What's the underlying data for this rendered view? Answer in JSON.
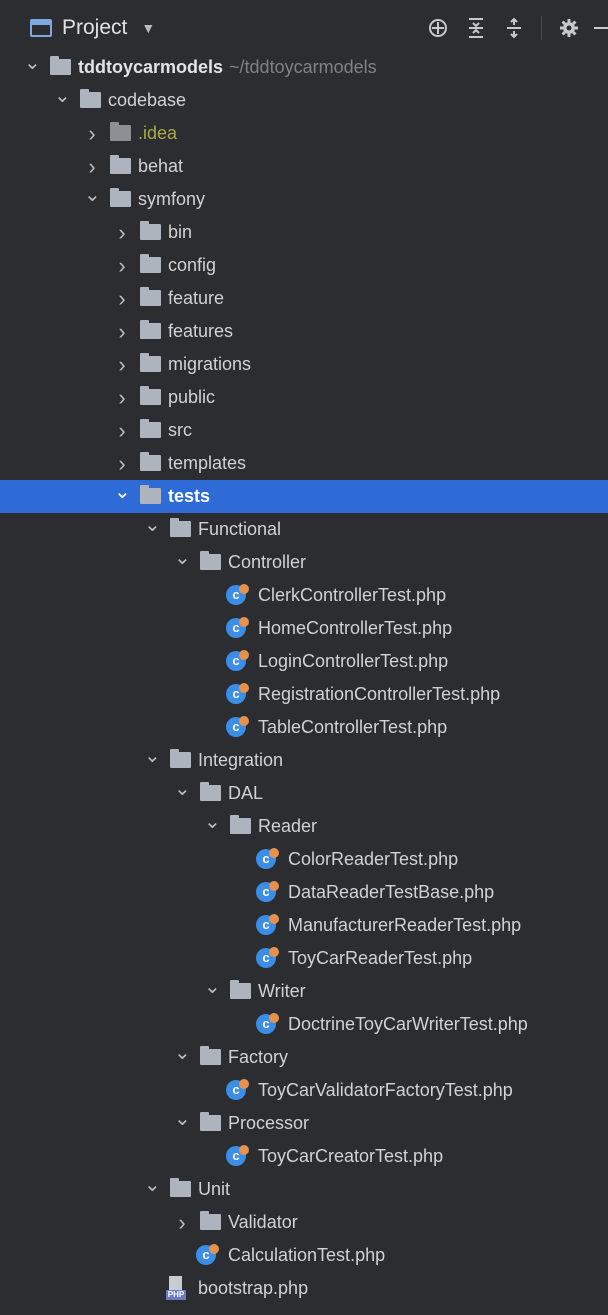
{
  "toolbar": {
    "title": "Project",
    "icons": [
      "locate-icon",
      "collapse-all-icon",
      "expand-all-icon",
      "gear-icon",
      "hide-icon"
    ]
  },
  "tree": [
    {
      "label": "tddtoycarmodels",
      "hint": "~/tddtoycarmodels",
      "type": "folder",
      "depth": 0,
      "expanded": true,
      "root": true
    },
    {
      "label": "codebase",
      "type": "folder",
      "depth": 1,
      "expanded": true
    },
    {
      "label": ".idea",
      "type": "folder-excluded",
      "depth": 2,
      "expanded": false
    },
    {
      "label": "behat",
      "type": "folder",
      "depth": 2,
      "expanded": false
    },
    {
      "label": "symfony",
      "type": "folder",
      "depth": 2,
      "expanded": true
    },
    {
      "label": "bin",
      "type": "folder",
      "depth": 3,
      "expanded": false
    },
    {
      "label": "config",
      "type": "folder",
      "depth": 3,
      "expanded": false
    },
    {
      "label": "feature",
      "type": "folder",
      "depth": 3,
      "expanded": false
    },
    {
      "label": "features",
      "type": "folder",
      "depth": 3,
      "expanded": false
    },
    {
      "label": "migrations",
      "type": "folder",
      "depth": 3,
      "expanded": false
    },
    {
      "label": "public",
      "type": "folder",
      "depth": 3,
      "expanded": false
    },
    {
      "label": "src",
      "type": "folder",
      "depth": 3,
      "expanded": false
    },
    {
      "label": "templates",
      "type": "folder",
      "depth": 3,
      "expanded": false
    },
    {
      "label": "tests",
      "type": "folder",
      "depth": 3,
      "expanded": true,
      "selected": true
    },
    {
      "label": "Functional",
      "type": "folder",
      "depth": 4,
      "expanded": true
    },
    {
      "label": "Controller",
      "type": "folder",
      "depth": 5,
      "expanded": true
    },
    {
      "label": "ClerkControllerTest.php",
      "type": "php-class",
      "depth": 6
    },
    {
      "label": "HomeControllerTest.php",
      "type": "php-class",
      "depth": 6
    },
    {
      "label": "LoginControllerTest.php",
      "type": "php-class",
      "depth": 6
    },
    {
      "label": "RegistrationControllerTest.php",
      "type": "php-class",
      "depth": 6
    },
    {
      "label": "TableControllerTest.php",
      "type": "php-class",
      "depth": 6
    },
    {
      "label": "Integration",
      "type": "folder",
      "depth": 4,
      "expanded": true
    },
    {
      "label": "DAL",
      "type": "folder",
      "depth": 5,
      "expanded": true
    },
    {
      "label": "Reader",
      "type": "folder",
      "depth": 6,
      "expanded": true
    },
    {
      "label": "ColorReaderTest.php",
      "type": "php-class",
      "depth": 7
    },
    {
      "label": "DataReaderTestBase.php",
      "type": "php-class",
      "depth": 7
    },
    {
      "label": "ManufacturerReaderTest.php",
      "type": "php-class",
      "depth": 7
    },
    {
      "label": "ToyCarReaderTest.php",
      "type": "php-class",
      "depth": 7
    },
    {
      "label": "Writer",
      "type": "folder",
      "depth": 6,
      "expanded": true
    },
    {
      "label": "DoctrineToyCarWriterTest.php",
      "type": "php-class",
      "depth": 7
    },
    {
      "label": "Factory",
      "type": "folder",
      "depth": 5,
      "expanded": true
    },
    {
      "label": "ToyCarValidatorFactoryTest.php",
      "type": "php-class",
      "depth": 6
    },
    {
      "label": "Processor",
      "type": "folder",
      "depth": 5,
      "expanded": true
    },
    {
      "label": "ToyCarCreatorTest.php",
      "type": "php-class",
      "depth": 6
    },
    {
      "label": "Unit",
      "type": "folder",
      "depth": 4,
      "expanded": true
    },
    {
      "label": "Validator",
      "type": "folder",
      "depth": 5,
      "expanded": false
    },
    {
      "label": "CalculationTest.php",
      "type": "php-class",
      "depth": 5
    },
    {
      "label": "bootstrap.php",
      "type": "php-file",
      "depth": 4
    }
  ]
}
